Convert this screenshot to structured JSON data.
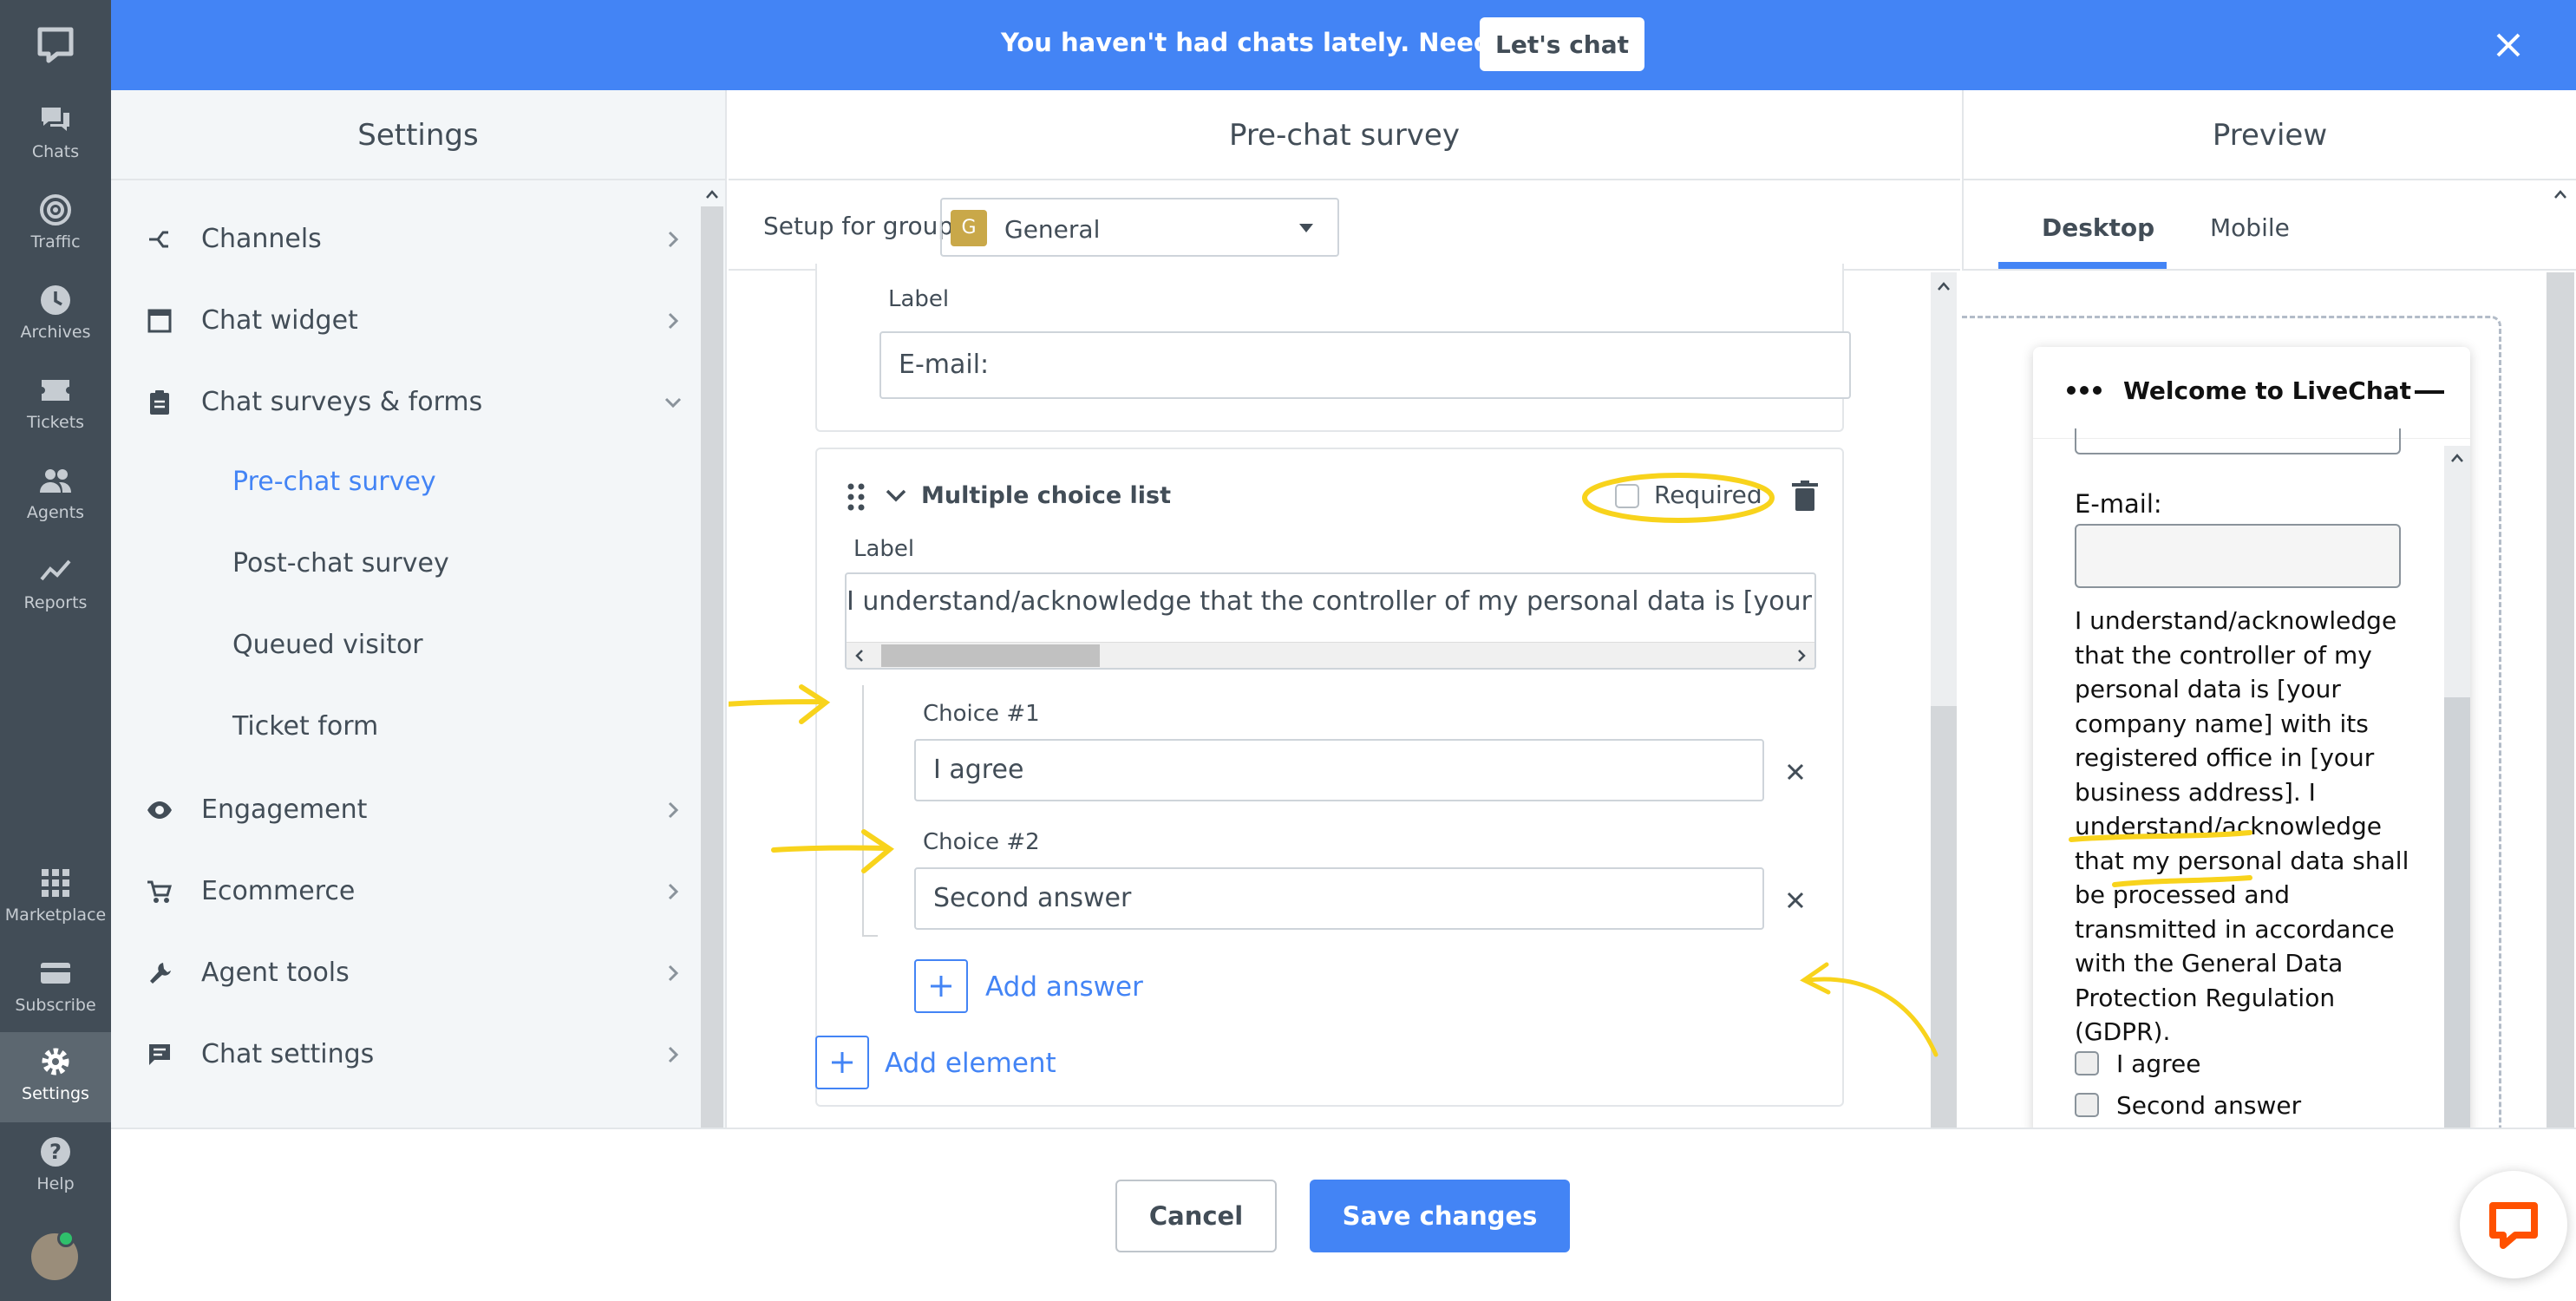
{
  "rail": {
    "items": [
      {
        "label": "Chats",
        "icon": "chat-bubbles-icon"
      },
      {
        "label": "Traffic",
        "icon": "target-icon"
      },
      {
        "label": "Archives",
        "icon": "clock-icon"
      },
      {
        "label": "Tickets",
        "icon": "ticket-icon"
      },
      {
        "label": "Agents",
        "icon": "people-icon"
      },
      {
        "label": "Reports",
        "icon": "chart-line-icon"
      },
      {
        "label": "Marketplace",
        "icon": "grid-icon"
      },
      {
        "label": "Subscribe",
        "icon": "card-icon"
      },
      {
        "label": "Settings",
        "icon": "gear-icon"
      },
      {
        "label": "Help",
        "icon": "help-icon"
      }
    ]
  },
  "banner": {
    "text": "You haven't had chats lately. Need help?",
    "button": "Let's chat"
  },
  "settings": {
    "title": "Settings",
    "menu": [
      {
        "label": "Channels"
      },
      {
        "label": "Chat widget"
      },
      {
        "label": "Chat surveys & forms"
      },
      {
        "label": "Engagement"
      },
      {
        "label": "Ecommerce"
      },
      {
        "label": "Agent tools"
      },
      {
        "label": "Chat settings"
      }
    ],
    "submenu": [
      "Pre-chat survey",
      "Post-chat survey",
      "Queued visitor",
      "Ticket form"
    ]
  },
  "center": {
    "title": "Pre-chat survey",
    "setup_label": "Setup for group",
    "group_badge": "G",
    "group_name": "General",
    "email_label": "Label",
    "email_value": "E-mail:",
    "mc_title": "Multiple choice list",
    "required_label": "Required",
    "mc_label": "Label",
    "mc_value": "I understand/acknowledge that the controller of my personal data is [your company",
    "choice1_label": "Choice #1",
    "choice1_value": "I agree",
    "choice2_label": "Choice #2",
    "choice2_value": "Second answer",
    "add_answer": "Add answer",
    "add_element": "Add element"
  },
  "preview": {
    "title": "Preview",
    "tab_desktop": "Desktop",
    "tab_mobile": "Mobile",
    "widget_title": "Welcome to LiveChat",
    "email_label": "E-mail:",
    "consent_lines": [
      "I understand/acknowledge",
      "that the controller of my",
      "personal data is [your",
      "company name] with its",
      "registered office in [your",
      "business address]. I",
      "understand/acknowledge",
      "that my personal data shall",
      "be processed and",
      "transmitted in accordance",
      "with the General Data",
      "Protection Regulation",
      "(GDPR)."
    ],
    "option1": "I agree",
    "option2": "Second answer"
  },
  "footer": {
    "cancel": "Cancel",
    "save": "Save changes"
  },
  "colors": {
    "brand_blue": "#4384f5",
    "rail_bg": "#424d57",
    "highlight_yellow": "#f8d31c",
    "chat_orange": "#ff5100"
  }
}
